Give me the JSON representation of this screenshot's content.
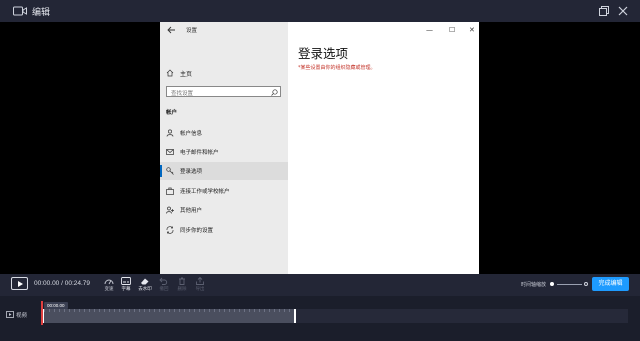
{
  "app": {
    "title": "编辑"
  },
  "settings": {
    "window_title": "设置",
    "home": "主页",
    "search_placeholder": "查找设置",
    "section": "帐户",
    "nav": [
      {
        "label": "帐户信息",
        "icon": "person-icon"
      },
      {
        "label": "电子邮件和帐户",
        "icon": "mail-icon"
      },
      {
        "label": "登录选项",
        "icon": "key-icon",
        "active": true
      },
      {
        "label": "连接工作或学校帐户",
        "icon": "briefcase-icon"
      },
      {
        "label": "其他用户",
        "icon": "add-user-icon"
      },
      {
        "label": "同步你的设置",
        "icon": "sync-icon"
      }
    ],
    "heading": "登录选项",
    "warning": "*某些设置由你的组织隐藏或管理。",
    "controls": {
      "minimize": "—",
      "maximize": "☐",
      "close": "✕"
    }
  },
  "player": {
    "timecode": "00:00.00 / 00:24.79",
    "tools": [
      {
        "label": "变速",
        "icon": "speed-icon",
        "enabled": true
      },
      {
        "label": "字幕",
        "icon": "subtitle-icon",
        "enabled": true
      },
      {
        "label": "去水印",
        "icon": "eraser-icon",
        "enabled": true
      },
      {
        "label": "撤回",
        "icon": "undo-icon",
        "enabled": false
      },
      {
        "label": "删除",
        "icon": "delete-icon",
        "enabled": false
      },
      {
        "label": "导出",
        "icon": "export-icon",
        "enabled": false
      }
    ],
    "zoom_label": "时间轴缩放",
    "finish_button": "完成编辑"
  },
  "timeline": {
    "track_label": "视频",
    "time_bubble": "00:00.00"
  },
  "colors": {
    "accent": "#1e9bff",
    "warning": "#c4352b",
    "playhead": "#e04040"
  }
}
